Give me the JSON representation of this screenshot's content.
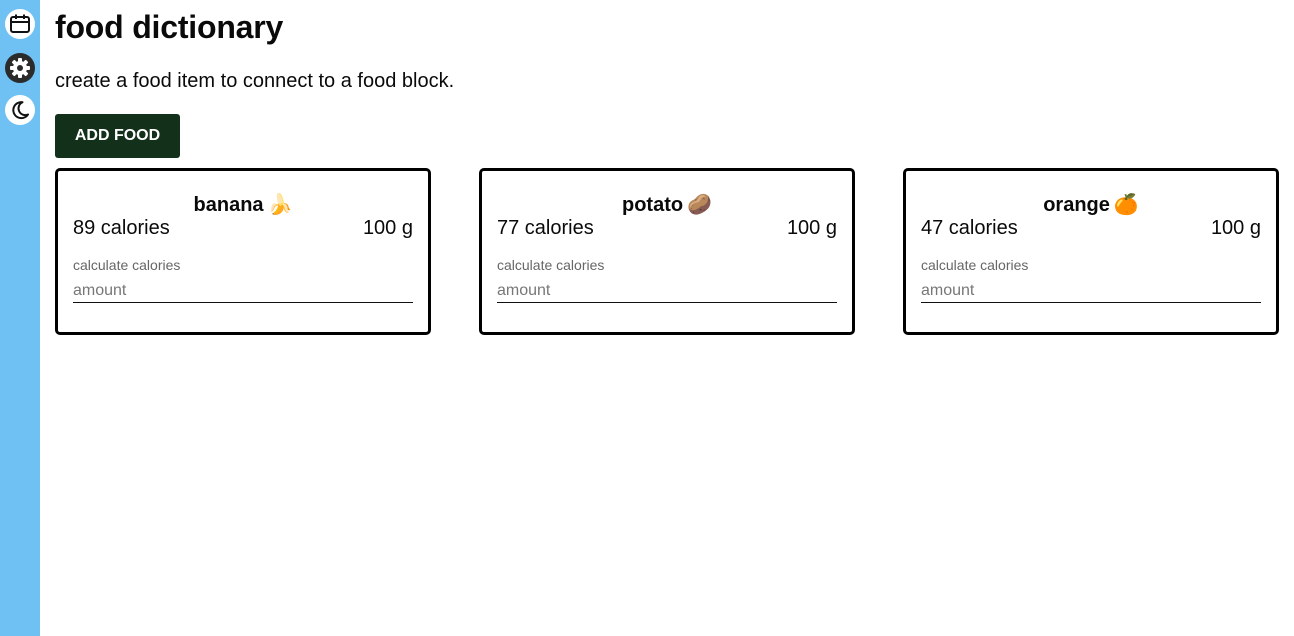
{
  "sidebar": {
    "items": [
      {
        "icon": "calendar-icon"
      },
      {
        "icon": "gear-icon"
      },
      {
        "icon": "moon-icon"
      }
    ]
  },
  "page": {
    "title": "food dictionary",
    "subtitle": "create a food item to connect to a food block.",
    "add_button": "ADD FOOD"
  },
  "foods": [
    {
      "name": "banana",
      "emoji": "🍌",
      "calories": "89 calories",
      "weight": "100 g",
      "calc_label": "calculate calories",
      "placeholder": "amount"
    },
    {
      "name": "potato",
      "emoji": "🥔",
      "calories": "77 calories",
      "weight": "100 g",
      "calc_label": "calculate calories",
      "placeholder": "amount"
    },
    {
      "name": "orange",
      "emoji": "🍊",
      "calories": "47 calories",
      "weight": "100 g",
      "calc_label": "calculate calories",
      "placeholder": "amount"
    }
  ],
  "colors": {
    "sidebar": "#6fc1f3",
    "button": "#13301a",
    "card_border": "#000000"
  }
}
